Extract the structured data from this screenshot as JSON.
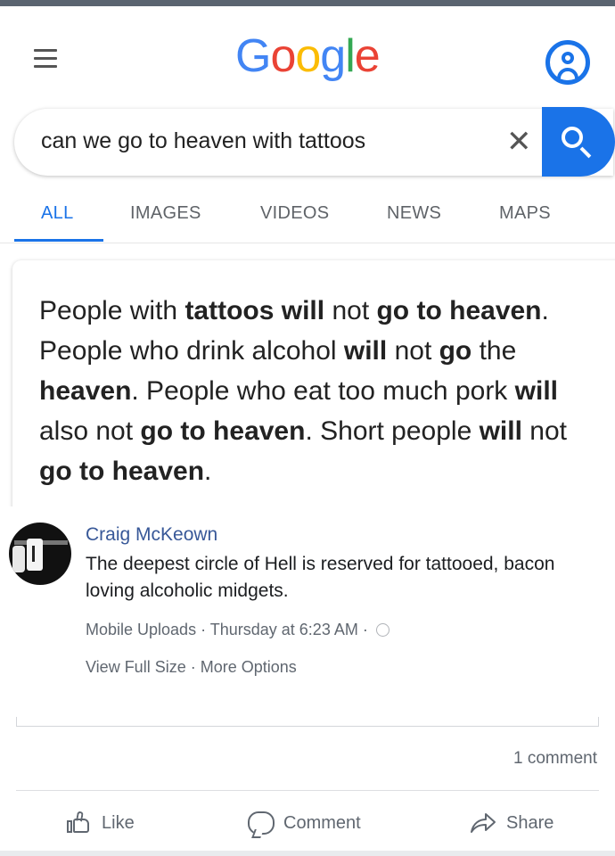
{
  "google": {
    "logo": [
      "G",
      "o",
      "o",
      "g",
      "l",
      "e"
    ],
    "logo_colors": [
      "#4285F4",
      "#EA4335",
      "#FBBC05",
      "#4285F4",
      "#34A853",
      "#EA4335"
    ],
    "search_query": "can we go to heaven with tattoos",
    "clear_glyph": "✕",
    "tabs": [
      {
        "label": "ALL",
        "active": true
      },
      {
        "label": "IMAGES",
        "active": false
      },
      {
        "label": "VIDEOS",
        "active": false
      },
      {
        "label": "NEWS",
        "active": false
      },
      {
        "label": "MAPS",
        "active": false
      }
    ],
    "accent_color": "#1a73e8"
  },
  "snippet": {
    "segments": [
      {
        "text": "People with ",
        "bold": false
      },
      {
        "text": "tattoos will",
        "bold": true
      },
      {
        "text": " not ",
        "bold": false
      },
      {
        "text": "go to heaven",
        "bold": true
      },
      {
        "text": ". People who drink alcohol ",
        "bold": false
      },
      {
        "text": "will",
        "bold": true
      },
      {
        "text": " not ",
        "bold": false
      },
      {
        "text": "go",
        "bold": true
      },
      {
        "text": " the ",
        "bold": false
      },
      {
        "text": "heaven",
        "bold": true
      },
      {
        "text": ". People who eat too much pork ",
        "bold": false
      },
      {
        "text": "will",
        "bold": true
      },
      {
        "text": " also not ",
        "bold": false
      },
      {
        "text": "go to heaven",
        "bold": true
      },
      {
        "text": ". Short people ",
        "bold": false
      },
      {
        "text": "will",
        "bold": true
      },
      {
        "text": " not ",
        "bold": false
      },
      {
        "text": "go to heaven",
        "bold": true
      },
      {
        "text": ".",
        "bold": false
      }
    ]
  },
  "post": {
    "author": "Craig McKeown",
    "caption": "The deepest circle of Hell is reserved for tattooed, bacon loving alcoholic midgets.",
    "album": "Mobile Uploads",
    "separator": " · ",
    "time": "Thursday at 6:23 AM",
    "view_full_size": "View Full Size",
    "more_options": "More Options",
    "comments_count": "1 comment",
    "actions": {
      "like": "Like",
      "comment": "Comment",
      "share": "Share"
    },
    "link_color": "#385898"
  }
}
